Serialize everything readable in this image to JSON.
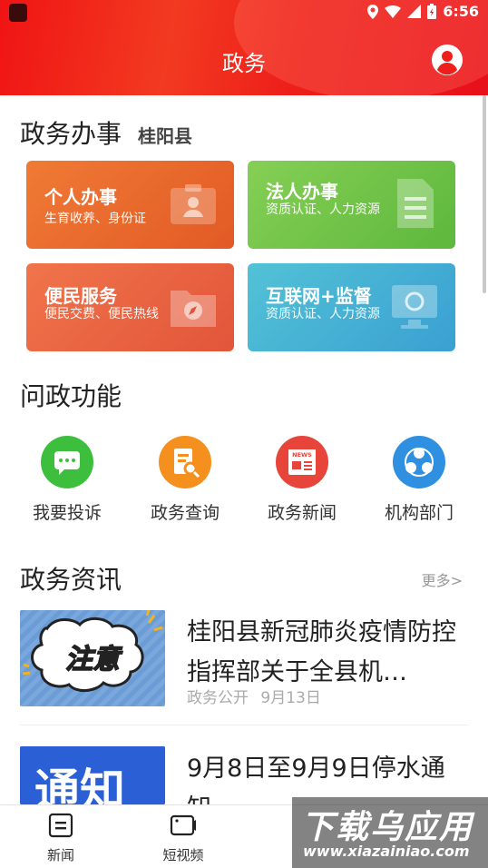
{
  "status_bar": {
    "time": "6:56"
  },
  "header": {
    "title": "政务"
  },
  "services": {
    "title": "政务办事",
    "region": "桂阳县",
    "cards": [
      {
        "title": "个人办事",
        "desc": "生育收养、身份证"
      },
      {
        "title": "法人办事",
        "desc": "资质认证、人力资源"
      },
      {
        "title": "便民服务",
        "desc": "便民交费、便民热线"
      },
      {
        "title": "互联网+监督",
        "desc": "资质认证、人力资源"
      }
    ]
  },
  "functions": {
    "title": "问政功能",
    "items": [
      {
        "label": "我要投诉",
        "color": "#3dbf3d"
      },
      {
        "label": "政务查询",
        "color": "#f5901e"
      },
      {
        "label": "政务新闻",
        "color": "#e8453a"
      },
      {
        "label": "机构部门",
        "color": "#2f8fe0"
      }
    ],
    "news_badge": "NEWS"
  },
  "news": {
    "title": "政务资讯",
    "more": "更多>",
    "items": [
      {
        "title": "桂阳县新冠肺炎疫情防控指挥部关于全县机…",
        "source": "政务公开",
        "date": "9月13日",
        "image_text": "注意"
      },
      {
        "title": "9月8日至9月9日停水通知",
        "image_text": "通知"
      }
    ]
  },
  "bottom_nav": {
    "tabs": [
      {
        "label": "新闻",
        "icon": "news-icon"
      },
      {
        "label": "短视频",
        "icon": "video-icon"
      }
    ]
  },
  "watermark": {
    "line1": "下载乌应用",
    "line2": "www.xiazainiao.com"
  }
}
